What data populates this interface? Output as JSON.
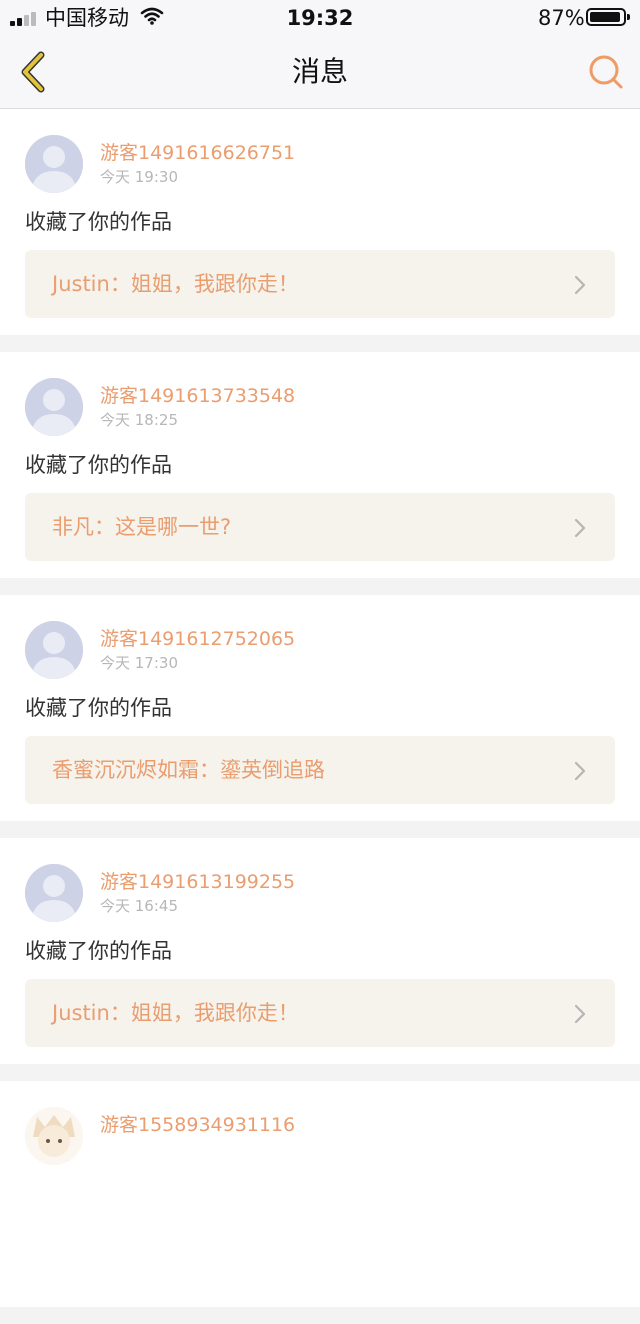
{
  "status_bar": {
    "carrier": "中国移动",
    "time": "19:32",
    "battery": "87%",
    "battery_level": 0.87
  },
  "header": {
    "title": "消息",
    "back_icon": "chevron-left-icon",
    "search_icon": "search-icon"
  },
  "colors": {
    "accent": "#ea9d6f",
    "back_icon": "#e2c33a",
    "quote_bg": "#f5f3ec"
  },
  "messages": [
    {
      "username": "游客1491616626751",
      "time": "今天 19:30",
      "action": "收藏了你的作品",
      "quote": "Justin：姐姐，我跟你走！"
    },
    {
      "username": "游客1491613733548",
      "time": "今天 18:25",
      "action": "收藏了你的作品",
      "quote": "非凡：这是哪一世?"
    },
    {
      "username": "游客1491612752065",
      "time": "今天 17:30",
      "action": "收藏了你的作品",
      "quote": "香蜜沉沉烬如霜：鎏英倒追路"
    },
    {
      "username": "游客1491613199255",
      "time": "今天 16:45",
      "action": "收藏了你的作品",
      "quote": "Justin：姐姐，我跟你走！"
    },
    {
      "username": "游客1558934931116"
    }
  ]
}
